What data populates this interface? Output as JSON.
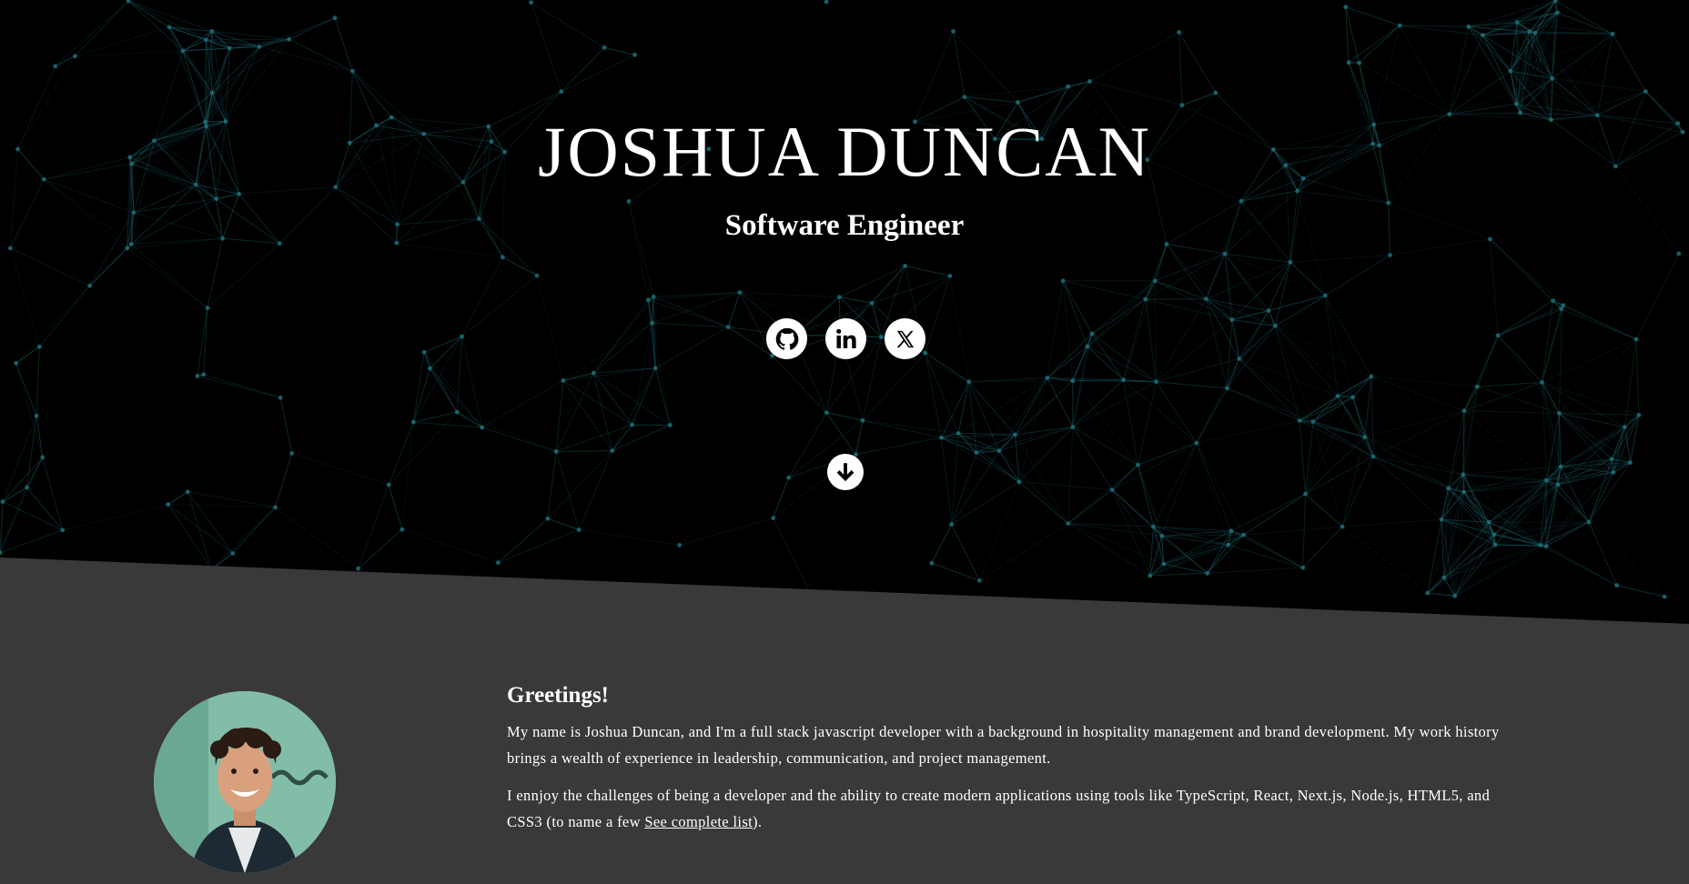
{
  "hero": {
    "name": "JOSHUA DUNCAN",
    "role": "Software Engineer"
  },
  "social": [
    {
      "label": "GitHub",
      "icon": "github-icon"
    },
    {
      "label": "LinkedIn",
      "icon": "linkedin-icon"
    },
    {
      "label": "X",
      "icon": "x-icon"
    }
  ],
  "scroll": {
    "icon": "arrow-down-icon"
  },
  "about": {
    "heading": "Greetings!",
    "paragraph1": "My name is Joshua Duncan, and I'm a full stack javascript developer with a background in hospitality management and brand development. My work history brings a wealth of experience in leadership, communication, and project management.",
    "paragraph2_before": "I ennjoy the challenges of being a developer and the ability to create modern applications using tools like TypeScript, React, Next.js, Node.js, HTML5, and CSS3 (to name a few ",
    "link_text": "See complete list",
    "paragraph2_after": ")."
  },
  "colors": {
    "hero_background": "#000000",
    "network_accent": "#1f6f78",
    "about_background": "#393939",
    "text": "#ffffff"
  }
}
